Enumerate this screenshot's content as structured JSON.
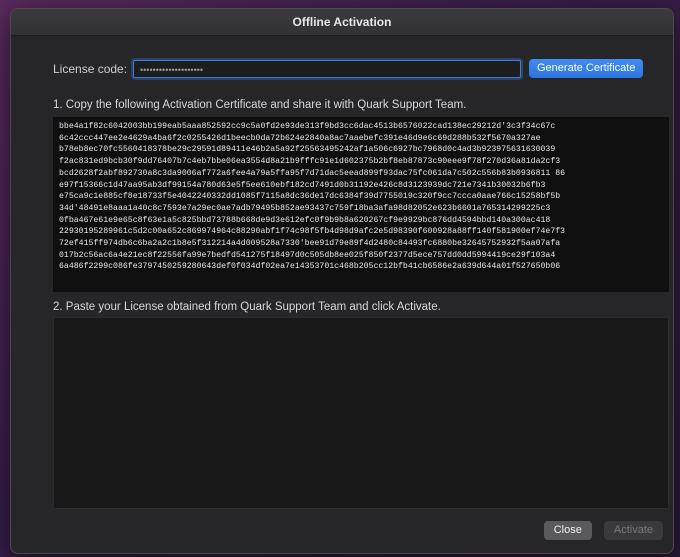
{
  "window": {
    "title": "Offline Activation"
  },
  "license": {
    "label": "License code:",
    "value": "••••••••••••••••••••",
    "generate_label": "Generate Certificate"
  },
  "steps": {
    "step1": "1. Copy the following Activation Certificate and share it with Quark Support Team.",
    "step2": "2. Paste your License obtained from Quark Support Team and click Activate."
  },
  "certificate_lines": [
    "bbe4a1f82c6042003bb199eab5aaa852592cc9c5a0fd2e93de313f9bd3cc6dac4513b6576022cad138ec29212d'3c3f34c67c",
    "6c42ccc447ee2e4629a4ba6f2c0255426d1beecb0da72b624e2840a8ac7aaebefc391e46d9e6c69d288b532f5670a327ae",
    "b78eb8ec70fc5560418378be29c29591d89411e46b2a5a92f25563495242af1a506c6927bc7968d0c4ad3b923975631630039",
    "f2ac831ed9bcb30f9dd76407b7c4eb7bbe06ea3554d8a21b9fffc91e1d602375b2bf8eb87873c90eee9f78f270d36a81da2cf3",
    "bcd2628f2abf892730a8c3da9006af772a6fee4a79a5ffa95f7d71dac5eead899f93dac75fc061da7c502c556b83b0936811 86",
    "e97f15366c1d47aa95ab3df99154a780d63e5f5ee610ebf182cd7491d0b31192e426c8d3123939dc721e7341b30032b6fb3",
    "e75ca9c1e885cf8e18733f5e4042240332dd1085f7115a8dc36de17dc6384f39d7755019c320f9cc7ccca0aae766c15258bf5b",
    "34d'48491e8aaa1a40c8c7593e7a29ec0ae7adb79495b852ae93437c759f18ba3afa98d82052e623b6601a765314299225c3",
    "0fba467e61e9e65c8f63e1a5c825bbd73788b668de9d3e612efc0f9b9b8a620267cf9e9929bc876dd4594bbd140a300ac418",
    "22930195289961c5d2c00a652c869974964c88290abf1f74c98f5fb4d98d9afc2e5d98390f600928a88ff140f581900ef74e7f3",
    "72ef415ff974db6c6ba2a2c1b8e5f312214a4d009528a7330'bee91d79e89f4d2480c84493fc6880be32645752932f5aa07afa",
    "017b2c56ac6a4e21ec8f22556fa99e7bedfd541275f18497d0c505db8ee025f850f2377d5ece757dd0dd5994419ce29f103a4",
    "6a486f2299c086fe3797450259280643def0f034df02ea7e14353701c468b205cc12bfb41cb6586e2a639d644a01f527650b06"
  ],
  "buttons": {
    "close": "Close",
    "activate": "Activate"
  }
}
